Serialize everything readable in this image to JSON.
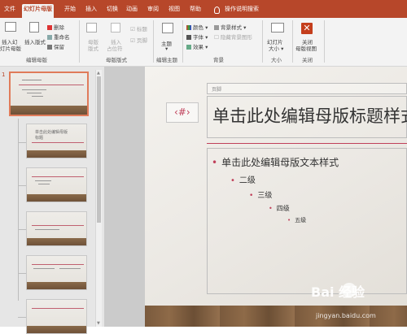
{
  "tabs": [
    {
      "label": "文件"
    },
    {
      "label": "幻灯片母版"
    },
    {
      "label": "开始"
    },
    {
      "label": "插入"
    },
    {
      "label": "切换"
    },
    {
      "label": "动画"
    },
    {
      "label": "审阅"
    },
    {
      "label": "视图"
    },
    {
      "label": "帮助"
    }
  ],
  "search_label": "操作说明搜索",
  "ribbon": {
    "insert_slide_master": [
      "插入幻",
      "灯片母版"
    ],
    "insert_layout": "插入版式",
    "delete": "删除",
    "rename": "重命名",
    "preserve": "保留",
    "master_layout": [
      "母版",
      "版式"
    ],
    "insert_placeholder": [
      "插入",
      "占位符"
    ],
    "title_checkbox": "标题",
    "footer_checkbox": "页脚",
    "theme": "主题",
    "colors": "颜色",
    "fonts": "字体",
    "effects": "效果",
    "background_styles": "背景样式",
    "hide_background": "隐藏背景图形",
    "slide_size": [
      "幻灯片",
      "大小"
    ],
    "close_master": [
      "关闭",
      "母版视图"
    ],
    "groups": {
      "edit_master": "编辑母版",
      "master_layout": "母版版式",
      "edit_theme": "编辑主题",
      "background": "背景",
      "size": "大小",
      "close": "关闭"
    }
  },
  "slide_panel": {
    "selected_number": "1",
    "thumb2_text": [
      "单击此处编辑母版",
      "标题"
    ]
  },
  "slide": {
    "footer_placeholder": "页脚",
    "number_placeholder": "‹#›",
    "title": "单击此处编辑母版标题样式",
    "body_levels": [
      "单击此处编辑母版文本样式",
      "二级",
      "三级",
      "四级",
      "五级"
    ]
  },
  "watermark": {
    "brand": "Bai 经验",
    "url": "jingyan.baidu.com"
  },
  "colors": {
    "accent": "#b7472a",
    "bullet": "#c0405a"
  }
}
